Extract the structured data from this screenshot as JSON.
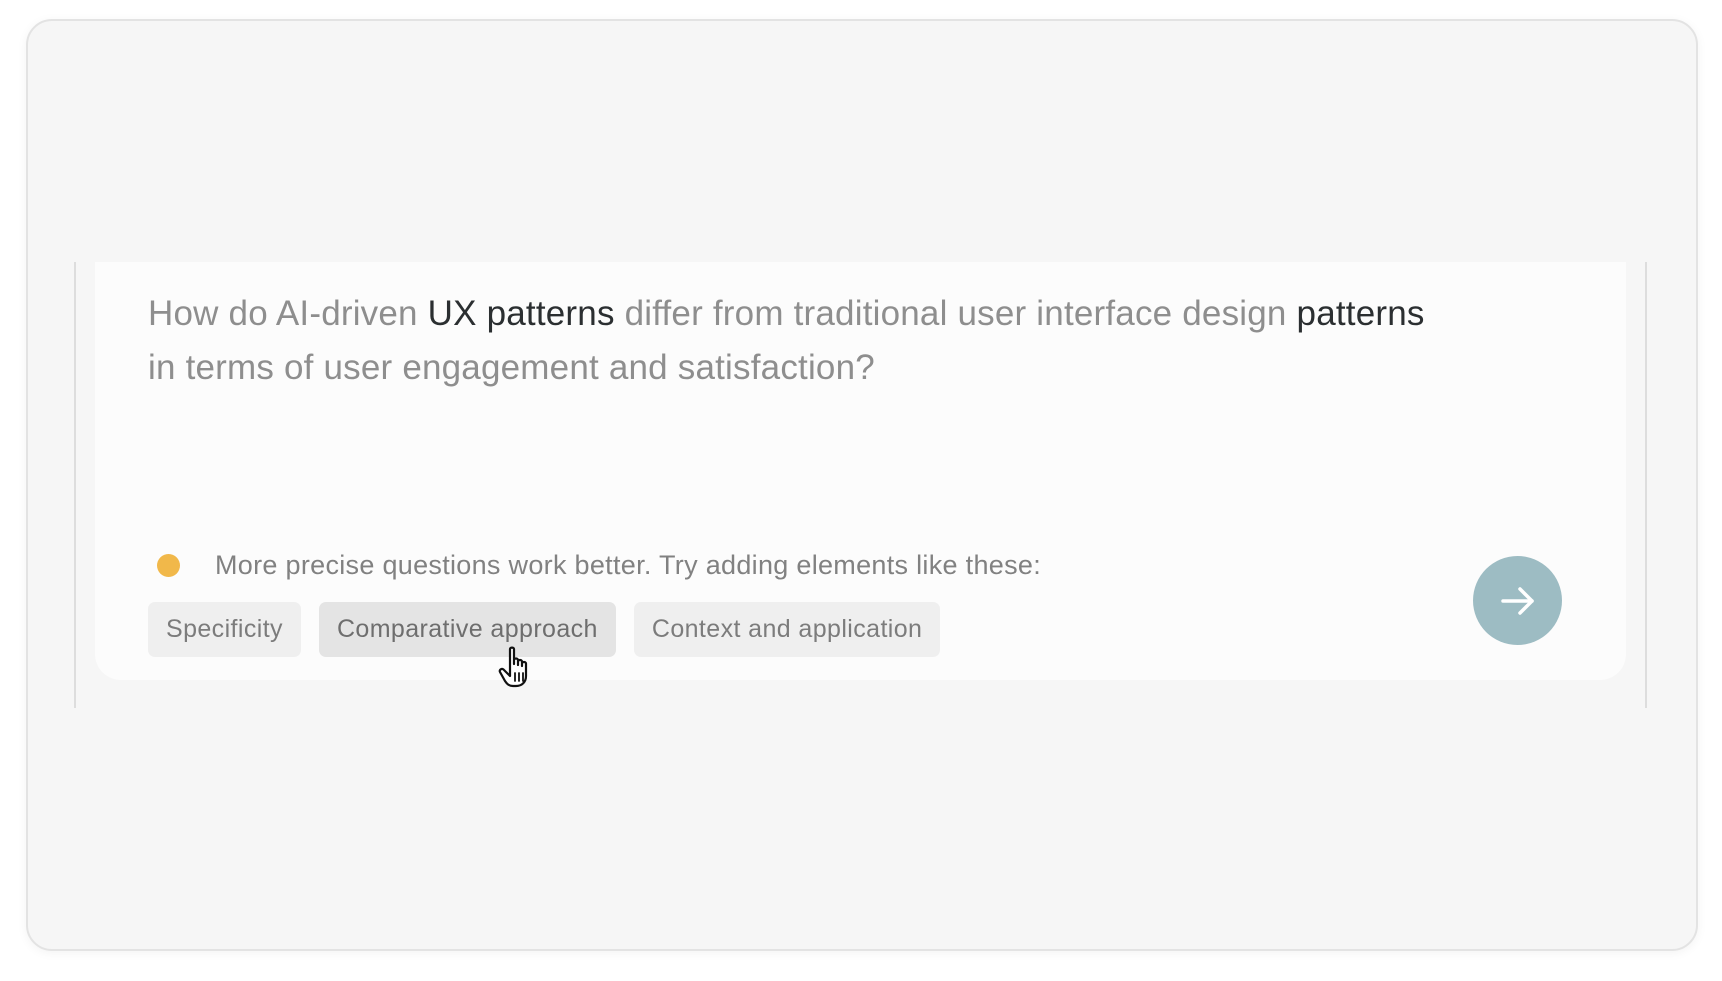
{
  "prompt": {
    "segments": [
      {
        "text": "How do AI-driven ",
        "emphasis": false
      },
      {
        "text": "UX patterns",
        "emphasis": true
      },
      {
        "text": " differ from traditional user interface design ",
        "emphasis": false
      },
      {
        "text": "patterns",
        "emphasis": true
      },
      {
        "text": " in terms of user engagement and satisfaction?",
        "emphasis": false
      }
    ]
  },
  "hint": {
    "text": "More precise questions work better. Try adding elements like these:",
    "indicator_color": "#f1b84a"
  },
  "suggestions": [
    {
      "label": "Specificity",
      "hovered": false
    },
    {
      "label": "Comparative approach",
      "hovered": true
    },
    {
      "label": "Context and application",
      "hovered": false
    }
  ],
  "submit": {
    "icon": "arrow-right-icon",
    "color": "#9dbcc3"
  },
  "pointer": {
    "icon": "hand-pointer-icon"
  }
}
